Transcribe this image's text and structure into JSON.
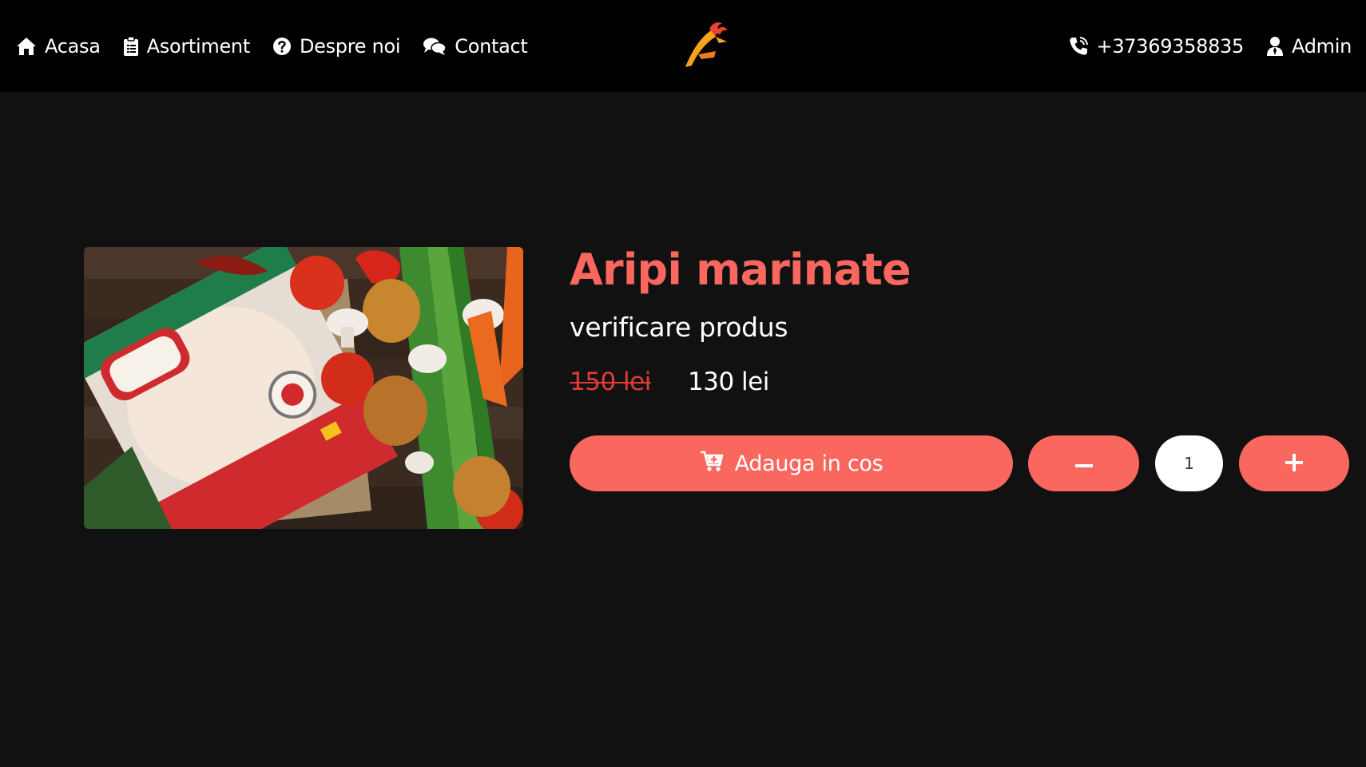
{
  "nav": {
    "items": [
      {
        "label": "Acasa",
        "icon": "home-icon"
      },
      {
        "label": "Asortiment",
        "icon": "clipboard-icon"
      },
      {
        "label": "Despre noi",
        "icon": "question-circle-icon"
      },
      {
        "label": "Contact",
        "icon": "chat-bubbles-icon"
      }
    ],
    "phone": {
      "label": "+37369358835",
      "icon": "phone-icon"
    },
    "admin": {
      "label": "Admin",
      "icon": "user-icon"
    },
    "logo_icon": "rooster-logo-icon"
  },
  "product": {
    "title": "Aripi marinate",
    "subtitle": "verificare produs",
    "old_price": "150 lei",
    "new_price": "130 lei",
    "add_to_cart_label": "Adauga in cos",
    "add_to_cart_icon": "cart-plus-icon",
    "quantity": "1",
    "minus_icon": "minus-icon",
    "plus_icon": "plus-icon"
  },
  "colors": {
    "accent": "#fa675f",
    "old_price": "#e03b36",
    "background": "#111111",
    "navbar": "#000000"
  }
}
